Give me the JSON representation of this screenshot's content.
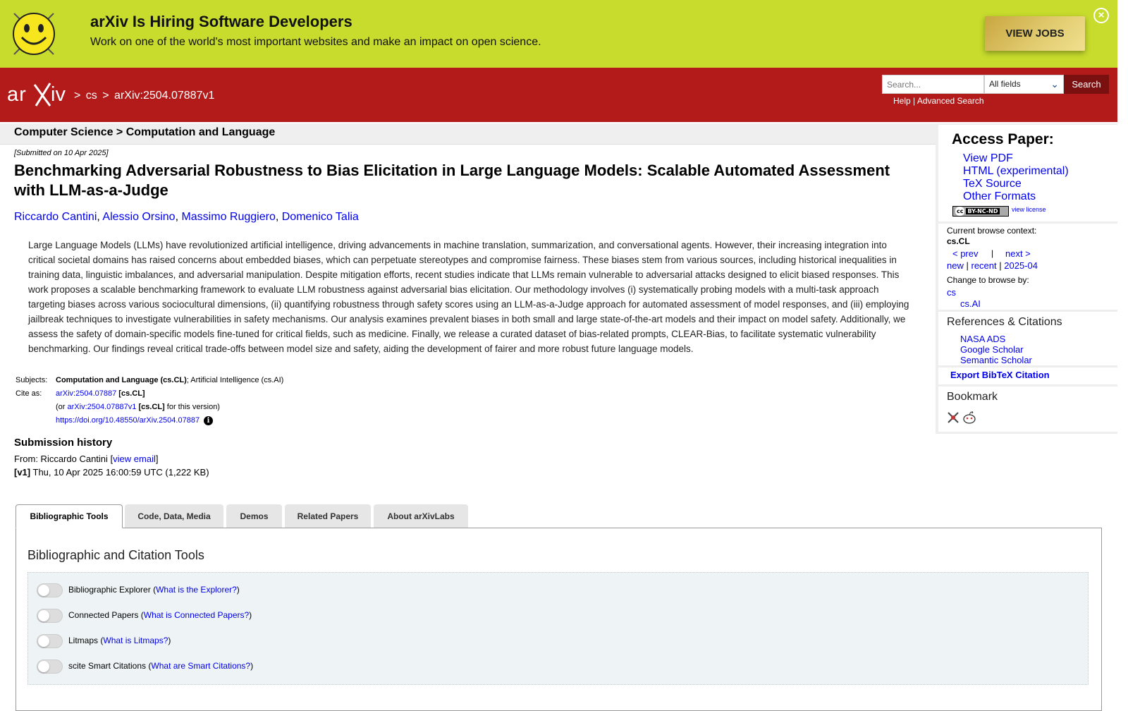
{
  "banner": {
    "title": "arXiv Is Hiring Software Developers",
    "subtitle": "Work on one of the world's most important websites and make an impact on open science.",
    "cta": "VIEW JOBS",
    "close_glyph": "×"
  },
  "header": {
    "breadcrumb": [
      ">",
      "cs",
      ">",
      "arXiv:2504.07887v1"
    ],
    "search_placeholder": "Search...",
    "field_selected": "All fields",
    "search_button": "Search",
    "help": "Help",
    "separator": "|",
    "advanced": "Advanced Search"
  },
  "category_bar": "Computer Science > Computation and Language",
  "submitted": "[Submitted on 10 Apr 2025]",
  "title": "Benchmarking Adversarial Robustness to Bias Elicitation in Large Language Models: Scalable Automated Assessment with LLM-as-a-Judge",
  "authors": [
    "Riccardo Cantini",
    "Alessio Orsino",
    "Massimo Ruggiero",
    "Domenico Talia"
  ],
  "author_sep": ", ",
  "abstract": "Large Language Models (LLMs) have revolutionized artificial intelligence, driving advancements in machine translation, summarization, and conversational agents. However, their increasing integration into critical societal domains has raised concerns about embedded biases, which can perpetuate stereotypes and compromise fairness. These biases stem from various sources, including historical inequalities in training data, linguistic imbalances, and adversarial manipulation. Despite mitigation efforts, recent studies indicate that LLMs remain vulnerable to adversarial attacks designed to elicit biased responses. This work proposes a scalable benchmarking framework to evaluate LLM robustness against adversarial bias elicitation. Our methodology involves (i) systematically probing models with a multi-task approach targeting biases across various sociocultural dimensions, (ii) quantifying robustness through safety scores using an LLM-as-a-Judge approach for automated assessment of model responses, and (iii) employing jailbreak techniques to investigate vulnerabilities in safety mechanisms. Our analysis examines prevalent biases in both small and large state-of-the-art models and their impact on model safety. Additionally, we assess the safety of domain-specific models fine-tuned for critical fields, such as medicine. Finally, we release a curated dataset of bias-related prompts, CLEAR-Bias, to facilitate systematic vulnerability benchmarking. Our findings reveal critical trade-offs between model size and safety, aiding the development of fairer and more robust future language models.",
  "meta": {
    "subjects_label": "Subjects:",
    "subjects_primary": "Computation and Language (cs.CL)",
    "subjects_rest": "; Artificial Intelligence (cs.AI)",
    "cite_label": "Cite as:",
    "cite_id": "arXiv:2504.07887",
    "cite_cat": "[cs.CL]",
    "cite_or": "(or",
    "cite_v_id": "arXiv:2504.07887v1",
    "cite_v_tail": "for this version)",
    "doi": "https://doi.org/10.48550/arXiv.2504.07887",
    "info_glyph": "i"
  },
  "submission": {
    "heading": "Submission history",
    "from_prefix": "From: Riccardo Cantini [",
    "view_email": "view email",
    "from_suffix": "]",
    "v1_label": "[v1]",
    "v1_text": "Thu, 10 Apr 2025 16:00:59 UTC (1,222 KB)"
  },
  "tabs": [
    "Bibliographic Tools",
    "Code, Data, Media",
    "Demos",
    "Related Papers",
    "About arXivLabs"
  ],
  "panel": {
    "heading": "Bibliographic and Citation Tools",
    "tools": [
      {
        "label": "Bibliographic Explorer",
        "link": "What is the Explorer?"
      },
      {
        "label": "Connected Papers",
        "link": "What is Connected Papers?"
      },
      {
        "label": "Litmaps",
        "link": "What is Litmaps?"
      },
      {
        "label": "scite Smart Citations",
        "link": "What are Smart Citations?"
      }
    ]
  },
  "sidebar": {
    "access_title": "Access Paper:",
    "access_links": [
      "View PDF",
      "HTML (experimental)",
      "TeX Source",
      "Other Formats"
    ],
    "license_badge_cc": "cc",
    "license_badge": "BY-NC-ND",
    "view_license": "view license",
    "browse_context_label": "Current browse context:",
    "browse_context": "cs.CL",
    "prev": "< prev",
    "nav_sep": "|",
    "next": "next >",
    "new": "new",
    "recent": "recent",
    "month": "2025-04",
    "change_browse": "Change to browse by:",
    "browse_cs": "cs",
    "browse_csai": "cs.AI",
    "refs_heading": "References & Citations",
    "refs": [
      "NASA ADS",
      "Google Scholar",
      "Semantic Scholar"
    ],
    "export": "Export BibTeX Citation",
    "bookmark": "Bookmark"
  }
}
